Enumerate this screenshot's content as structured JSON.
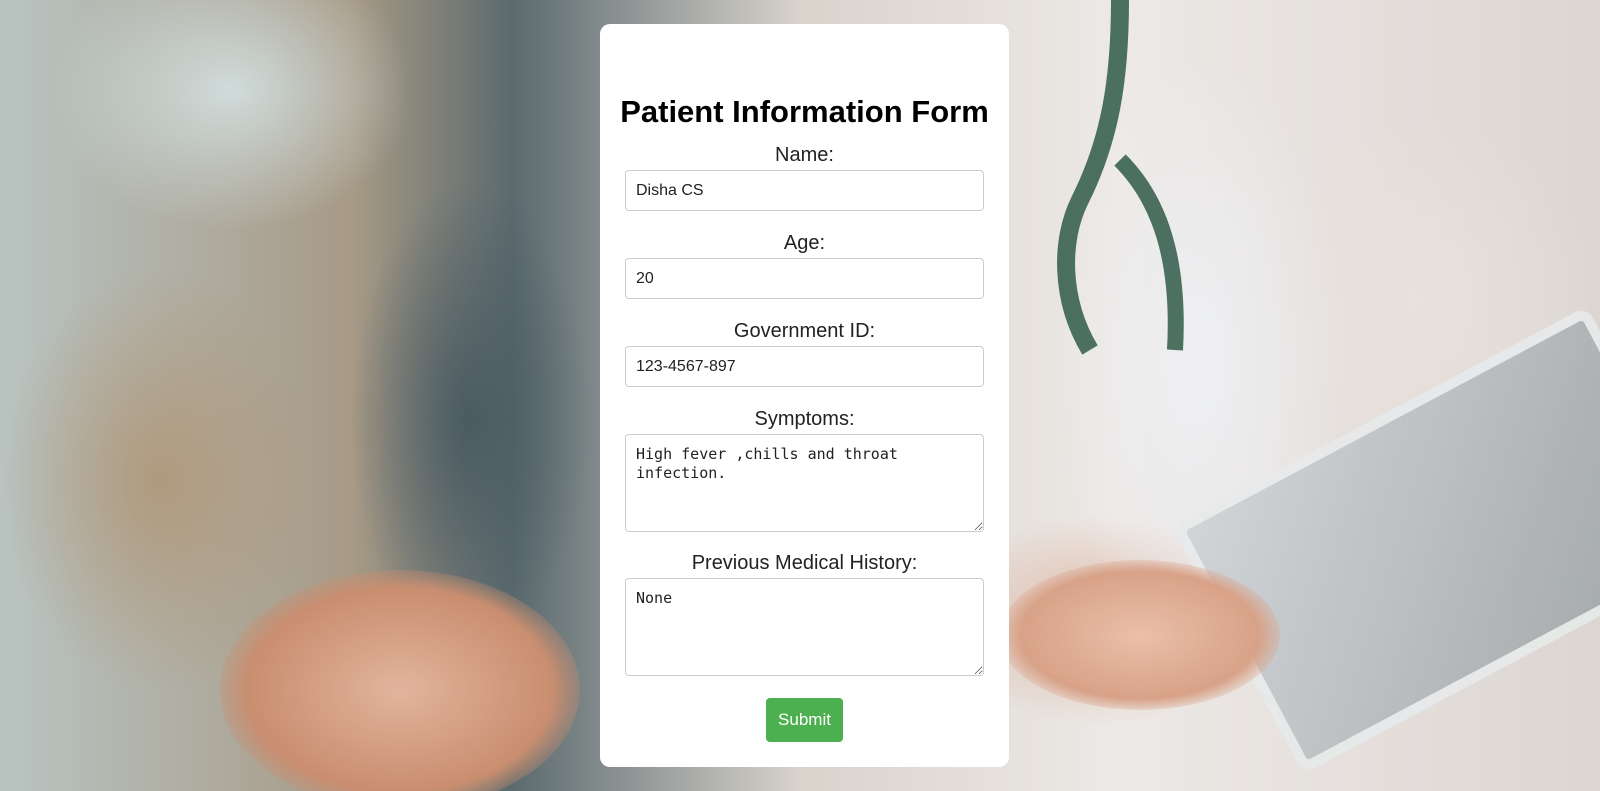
{
  "form": {
    "title": "Patient Information Form",
    "fields": {
      "name": {
        "label": "Name:",
        "value": "Disha CS"
      },
      "age": {
        "label": "Age:",
        "value": "20"
      },
      "government_id": {
        "label": "Government ID:",
        "value": "123-4567-897"
      },
      "symptoms": {
        "label": "Symptoms:",
        "value": "High fever ,chills and throat infection."
      },
      "medical_history": {
        "label": "Previous Medical History:",
        "value": "None"
      }
    },
    "submit_label": "Submit"
  },
  "colors": {
    "card_background": "#ffffff",
    "submit_button": "#4caf50",
    "input_border": "#cccccc"
  }
}
